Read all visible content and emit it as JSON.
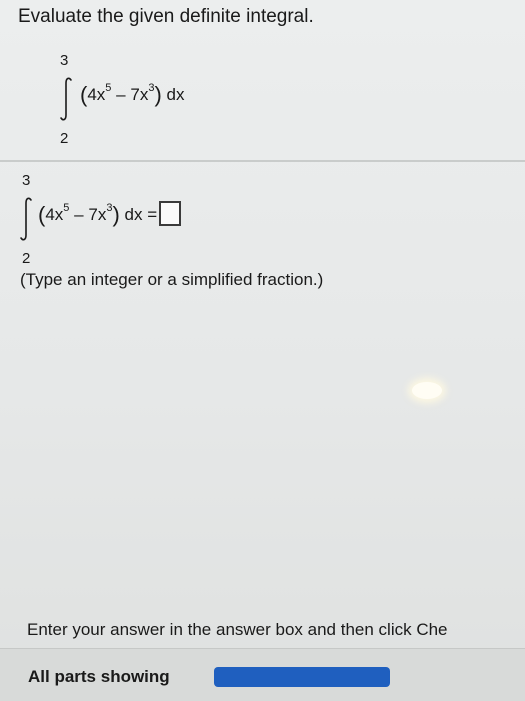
{
  "question": {
    "title": "Evaluate the given definite integral."
  },
  "integral_display": {
    "upper": "3",
    "lower": "2",
    "term1": "4x",
    "term1_exp": "5",
    "minus": "–",
    "term2": "7x",
    "term2_exp": "3",
    "open_paren": "(",
    "close_paren": ")",
    "dx": "dx"
  },
  "answer_row": {
    "upper": "3",
    "lower": "2",
    "term1": "4x",
    "term1_exp": "5",
    "minus": "–",
    "term2": "7x",
    "term2_exp": "3",
    "open_paren": "(",
    "close_paren": ")",
    "dx_equals": "dx =",
    "answer_value": ""
  },
  "hint": "(Type an integer or a simplified fraction.)",
  "footer": {
    "instruction": "Enter your answer in the answer box and then click Che",
    "parts_label": "All parts showing",
    "progress_fraction": 1.0
  },
  "colors": {
    "progress": "#1f5fbf",
    "divider": "#c9cccb"
  },
  "icons": {
    "answer_box": "empty-square"
  }
}
